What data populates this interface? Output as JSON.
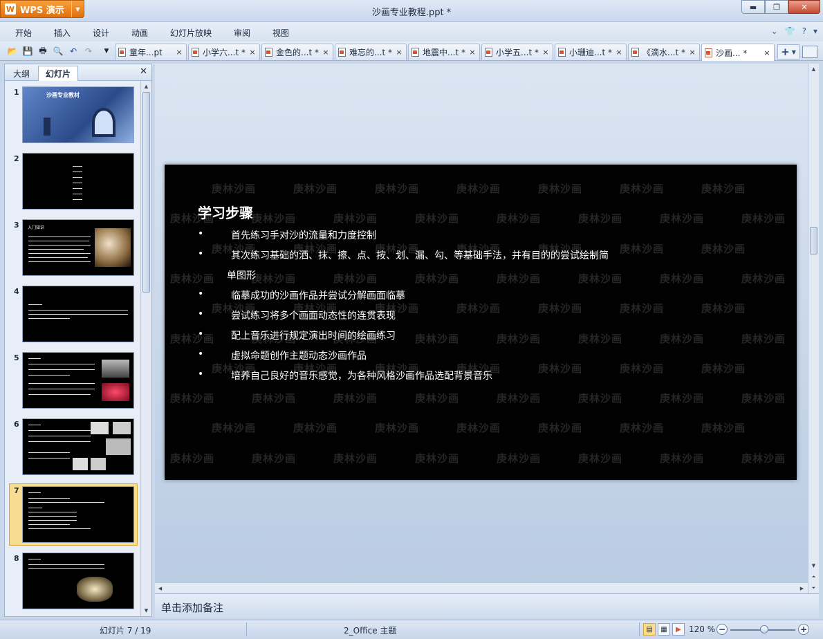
{
  "app": {
    "name": "WPS 演示",
    "logo_text": "W",
    "window_title": "沙画专业教程.ppt *"
  },
  "menu": [
    "开始",
    "插入",
    "设计",
    "动画",
    "幻灯片放映",
    "审阅",
    "视图"
  ],
  "tabs": [
    {
      "label": "童年...pt",
      "close": "×"
    },
    {
      "label": "小学六...t *",
      "close": "×"
    },
    {
      "label": "金色的...t *",
      "close": "×"
    },
    {
      "label": "难忘的...t *",
      "close": "×"
    },
    {
      "label": "地震中...t *",
      "close": "×"
    },
    {
      "label": "小学五...t *",
      "close": "×"
    },
    {
      "label": "小珊迪...t *",
      "close": "×"
    },
    {
      "label": "《滴水...t *",
      "close": "×"
    },
    {
      "label": "沙画... *",
      "close": "×"
    }
  ],
  "left_pane": {
    "tabs": [
      "大纲",
      "幻灯片"
    ],
    "active_tab": "幻灯片",
    "slide_numbers": [
      "1",
      "2",
      "3",
      "4",
      "5",
      "6",
      "7",
      "8"
    ],
    "slide1_title": "沙画专业教材",
    "slide3_title": "入门知识"
  },
  "slide": {
    "watermark": "庚林沙画",
    "title": "学习步骤",
    "bullet_char": "•",
    "bullets": [
      "首先练习手对沙的流量和力度控制",
      "其次练习基础的洒、抹、擦、点、按、划、漏、勾、等基础手法，并有目的的尝试绘制简",
      "临摹成功的沙画作品并尝试分解画面临摹",
      "尝试练习将多个画面动态性的连贯表现",
      "配上音乐进行规定演出时间的绘画练习",
      "虚拟命题创作主题动态沙画作品",
      "培养自己良好的音乐感觉，为各种风格沙画作品选配背景音乐"
    ],
    "continuation": "单图形"
  },
  "notes_placeholder": "单击添加备注",
  "status": {
    "slide_counter": "幻灯片 7 / 19",
    "theme": "2_Office 主题",
    "zoom": "120 %",
    "zoom_level_percent": 120
  },
  "colors": {
    "accent": "#e0700e",
    "selected_thumb": "#f8dc90",
    "slide_bg": "#020202"
  }
}
